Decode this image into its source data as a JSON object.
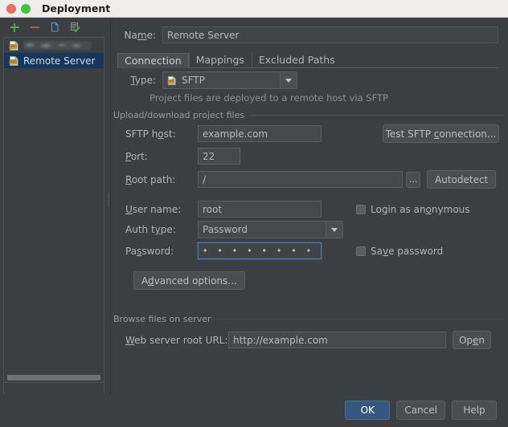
{
  "window": {
    "title": "Deployment",
    "controls": {
      "close": "close-button",
      "maximize": "maximize-button"
    }
  },
  "sidebar": {
    "toolbar": [
      {
        "name": "add-button",
        "glyph": "+",
        "tooltip": "Add"
      },
      {
        "name": "remove-button",
        "glyph": "–",
        "tooltip": "Remove"
      },
      {
        "name": "copy-button",
        "glyph": "copy",
        "tooltip": "Copy"
      },
      {
        "name": "set-default-button",
        "glyph": "check",
        "tooltip": "Use as default"
      }
    ],
    "items": [
      {
        "label": "",
        "redacted": true,
        "selected": false
      },
      {
        "label": "Remote Server",
        "redacted": false,
        "selected": true
      }
    ]
  },
  "form": {
    "name_label": "Name:",
    "name_value": "Remote Server",
    "tabs": [
      {
        "label": "Connection",
        "active": true
      },
      {
        "label": "Mappings",
        "active": false
      },
      {
        "label": "Excluded Paths",
        "active": false
      }
    ],
    "type_label": "Type:",
    "type_value": "SFTP",
    "type_hint": "Project files are deployed to a remote host via SFTP",
    "upload_group": "Upload/download project files",
    "sftp_host_label": "SFTP host:",
    "sftp_host_value": "example.com",
    "test_connection_button": "Test SFTP connection...",
    "port_label": "Port:",
    "port_value": "22",
    "root_path_label": "Root path:",
    "root_path_value": "/",
    "browse_button": "...",
    "autodetect_button": "Autodetect",
    "user_name_label": "User name:",
    "user_name_value": "root",
    "login_anonymous_label": "Login as anonymous",
    "login_anonymous_checked": false,
    "auth_type_label": "Auth type:",
    "auth_type_value": "Password",
    "password_label": "Password:",
    "password_value": "• • • • • • • • • • • •",
    "save_password_label": "Save password",
    "save_password_checked": false,
    "advanced_options_button": "Advanced options...",
    "browse_group": "Browse files on server",
    "web_url_label": "Web server root URL:",
    "web_url_value": "http://example.com",
    "open_button": "Open"
  },
  "buttons": {
    "ok": "OK",
    "cancel": "Cancel",
    "help": "Help"
  },
  "colors": {
    "window_bg": "#3c3f41",
    "titlebar_bg": "#f0eeec",
    "selection_blue": "#12385e",
    "primary_button": "#365880",
    "focus_border": "#4a7ebb",
    "close_dot": "#ed6a5e",
    "max_dot": "#3cc840",
    "icon_green": "#5a9e5a",
    "icon_red": "#b05b52",
    "server_icon_gold": "#d5a63c"
  }
}
